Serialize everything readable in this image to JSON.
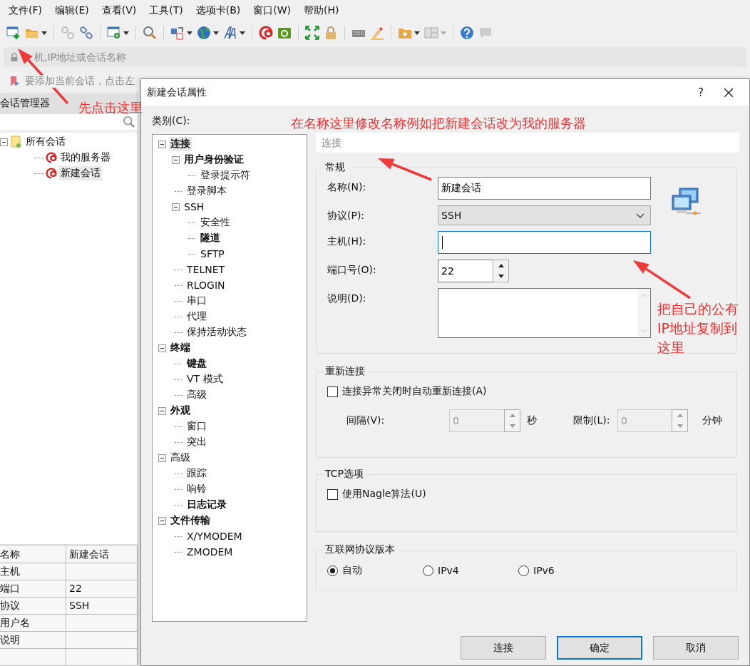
{
  "menu": [
    "文件(F)",
    "编辑(E)",
    "查看(V)",
    "工具(T)",
    "选项卡(B)",
    "窗口(W)",
    "帮助(H)"
  ],
  "address_bar": {
    "placeholder": "机,IP地址或会话名称"
  },
  "hint_bar": {
    "text": "要添加当前会话，点击左"
  },
  "session_manager": {
    "title": "会话管理器",
    "tree": [
      {
        "label": "所有会话",
        "kind": "folder",
        "expanded": true,
        "selected": false,
        "children": [
          {
            "label": "我的服务器",
            "kind": "session",
            "selected": false
          },
          {
            "label": "新建会话",
            "kind": "session",
            "selected": true
          }
        ]
      }
    ],
    "properties": [
      {
        "name": "名称",
        "value": "新建会话"
      },
      {
        "name": "主机"
      },
      {
        "name": "端口",
        "value": "22"
      },
      {
        "name": "协议",
        "value": "SSH"
      },
      {
        "name": "用户名"
      },
      {
        "name": "说明"
      }
    ]
  },
  "dialog": {
    "title": "新建会话属性",
    "help": "?",
    "category_label": "类别(C):",
    "categories": [
      {
        "label": "连接",
        "bold": true,
        "selected": true,
        "expanded": true,
        "children": [
          {
            "label": "用户身份验证",
            "bold": true,
            "selected": false,
            "expanded": true,
            "children": [
              {
                "label": "登录提示符",
                "bold": false,
                "selected": false
              }
            ]
          },
          {
            "label": "登录脚本",
            "bold": false,
            "selected": false
          },
          {
            "label": "SSH",
            "bold": false,
            "selected": false,
            "expanded": true,
            "children": [
              {
                "label": "安全性",
                "bold": false,
                "selected": false
              },
              {
                "label": "隧道",
                "bold": true,
                "selected": false
              },
              {
                "label": "SFTP",
                "bold": false,
                "selected": false
              }
            ]
          },
          {
            "label": "TELNET",
            "bold": false,
            "selected": false
          },
          {
            "label": "RLOGIN",
            "bold": false,
            "selected": false
          },
          {
            "label": "串口",
            "bold": false,
            "selected": false
          },
          {
            "label": "代理",
            "bold": false,
            "selected": false
          },
          {
            "label": "保持活动状态",
            "bold": false,
            "selected": false
          }
        ]
      },
      {
        "label": "终端",
        "bold": true,
        "selected": false,
        "expanded": true,
        "children": [
          {
            "label": "键盘",
            "bold": true,
            "selected": false
          },
          {
            "label": "VT 模式",
            "bold": false,
            "selected": false
          },
          {
            "label": "高级",
            "bold": false,
            "selected": false
          }
        ]
      },
      {
        "label": "外观",
        "bold": true,
        "selected": false,
        "expanded": true,
        "children": [
          {
            "label": "窗口",
            "bold": false,
            "selected": false
          },
          {
            "label": "突出",
            "bold": false,
            "selected": false
          }
        ]
      },
      {
        "label": "高级",
        "bold": false,
        "selected": false,
        "expanded": true,
        "children": [
          {
            "label": "跟踪",
            "bold": false,
            "selected": false
          },
          {
            "label": "响铃",
            "bold": false,
            "selected": false
          },
          {
            "label": "日志记录",
            "bold": true,
            "selected": false
          }
        ]
      },
      {
        "label": "文件传输",
        "bold": true,
        "selected": false,
        "expanded": true,
        "children": [
          {
            "label": "X/YMODEM",
            "bold": false,
            "selected": false
          },
          {
            "label": "ZMODEM",
            "bold": false,
            "selected": false
          }
        ]
      }
    ],
    "page_title": "连接",
    "general": {
      "title": "常规",
      "fields": [
        {
          "kind": "text",
          "label": "名称(N):",
          "value": "新建会话",
          "focused": false
        },
        {
          "kind": "select",
          "label": "协议(P):",
          "value": "SSH"
        },
        {
          "kind": "text",
          "label": "主机(H):",
          "focused": true
        },
        {
          "kind": "spin",
          "label": "端口号(O):",
          "value": "22"
        },
        {
          "kind": "textarea",
          "label": "说明(D):"
        }
      ]
    },
    "reconnect": {
      "title": "重新连接",
      "checkbox": {
        "label": "连接异常关闭时自动重新连接(A)",
        "checked": false
      },
      "spins": [
        {
          "label": "间隔(V):",
          "value": "0",
          "unit": "秒",
          "disabled": true
        },
        {
          "label": "限制(L):",
          "value": "0",
          "unit": "分钟",
          "disabled": true
        }
      ]
    },
    "tcp": {
      "title": "TCP选项",
      "checkbox": {
        "label": "使用Nagle算法(U)",
        "checked": false
      }
    },
    "ip_version": {
      "title": "互联网协议版本",
      "options": [
        {
          "label": "自动",
          "selected": true
        },
        {
          "label": "IPv4",
          "selected": false
        },
        {
          "label": "IPv6",
          "selected": false
        }
      ]
    },
    "buttons": [
      {
        "label": "连接",
        "default": false
      },
      {
        "label": "确定",
        "default": true
      },
      {
        "label": "取消",
        "default": false
      }
    ]
  },
  "annotations": [
    {
      "text": "先点击这里"
    },
    {
      "text": "在名称这里修改名称例如把新建会话改为我的服务器"
    },
    {
      "text": "把自己的公有IP地址复制到这里"
    }
  ]
}
